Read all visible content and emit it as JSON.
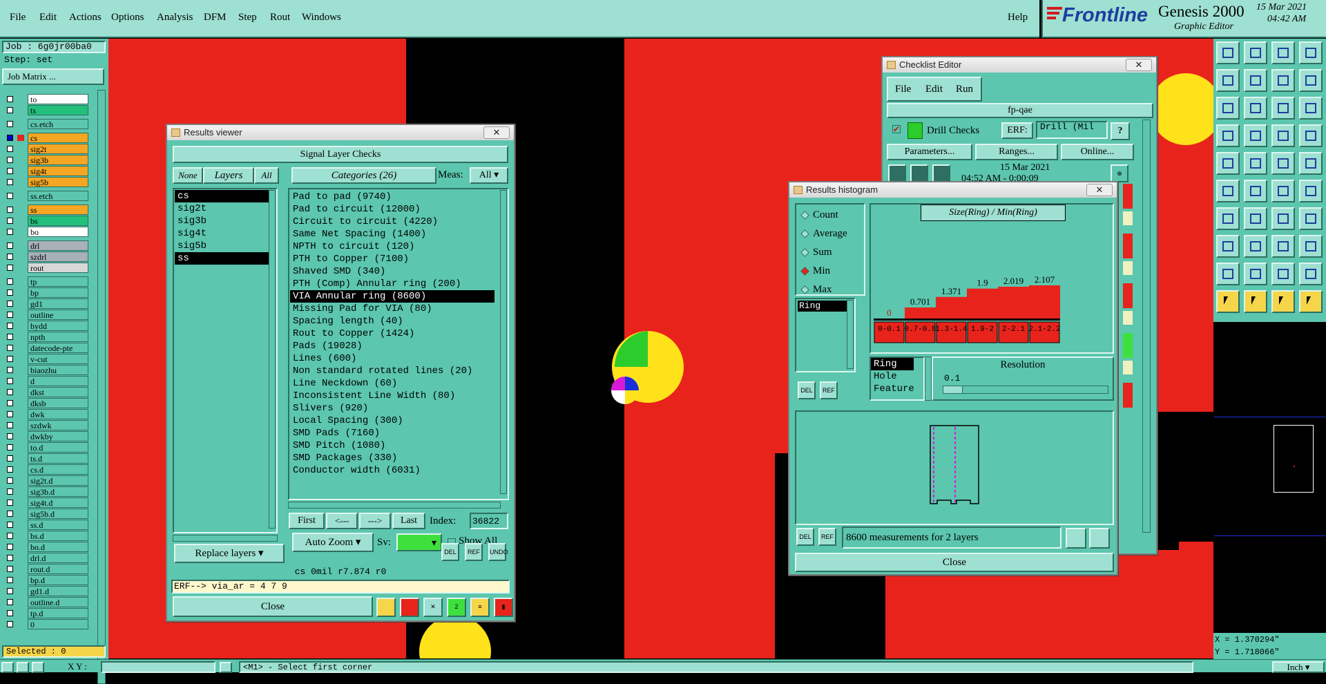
{
  "menu": {
    "items": [
      "File",
      "Edit",
      "Actions",
      "Options",
      "Analysis",
      "DFM",
      "Step",
      "Rout",
      "Windows"
    ],
    "help": "Help"
  },
  "brand": {
    "logo": "Frontline",
    "product": "Genesis 2000",
    "subtitle": "Graphic Editor",
    "date": "15 Mar 2021",
    "time": "04:42 AM"
  },
  "left": {
    "job": "Job : 6g0jr00ba0",
    "step": "Step: set",
    "job_matrix": "Job Matrix ...",
    "layers": [
      {
        "name": "to",
        "color": "#ffffff",
        "sel": false
      },
      {
        "name": "ts",
        "color": "#22c07a",
        "sel": false
      },
      {
        "name": "cs.etch",
        "color": "#5cc6ae",
        "sel": false
      },
      {
        "name": "cs",
        "color": "#f5a623",
        "sel": true
      },
      {
        "name": "sig2t",
        "color": "#f5a623",
        "sel": false
      },
      {
        "name": "sig3b",
        "color": "#f5a623",
        "sel": false
      },
      {
        "name": "sig4t",
        "color": "#f5a623",
        "sel": false
      },
      {
        "name": "sig5b",
        "color": "#f5a623",
        "sel": false
      },
      {
        "name": "ss.etch",
        "color": "#5cc6ae",
        "sel": false
      },
      {
        "name": "ss",
        "color": "#f5a623",
        "sel": false
      },
      {
        "name": "bs",
        "color": "#22c07a",
        "sel": false
      },
      {
        "name": "bo",
        "color": "#ffffff",
        "sel": false
      },
      {
        "name": "drl",
        "color": "#a8b0b8",
        "sel": false
      },
      {
        "name": "szdrl",
        "color": "#a8b0b8",
        "sel": false
      },
      {
        "name": "rout",
        "color": "#d8d8d8",
        "sel": false
      },
      {
        "name": "tp",
        "color": "#5cc6ae",
        "sel": false
      },
      {
        "name": "bp",
        "color": "#5cc6ae",
        "sel": false
      },
      {
        "name": "gd1",
        "color": "#5cc6ae",
        "sel": false
      },
      {
        "name": "outline",
        "color": "#5cc6ae",
        "sel": false
      },
      {
        "name": "bydd",
        "color": "#5cc6ae",
        "sel": false
      },
      {
        "name": "npth",
        "color": "#5cc6ae",
        "sel": false
      },
      {
        "name": "datecode-pte",
        "color": "#5cc6ae",
        "sel": false
      },
      {
        "name": "v-cut",
        "color": "#5cc6ae",
        "sel": false
      },
      {
        "name": "biaozhu",
        "color": "#5cc6ae",
        "sel": false
      },
      {
        "name": "d",
        "color": "#5cc6ae",
        "sel": false
      },
      {
        "name": "dkst",
        "color": "#5cc6ae",
        "sel": false
      },
      {
        "name": "dksb",
        "color": "#5cc6ae",
        "sel": false
      },
      {
        "name": "dwk",
        "color": "#5cc6ae",
        "sel": false
      },
      {
        "name": "szdwk",
        "color": "#5cc6ae",
        "sel": false
      },
      {
        "name": "dwkby",
        "color": "#5cc6ae",
        "sel": false
      },
      {
        "name": "to.d",
        "color": "#5cc6ae",
        "sel": false
      },
      {
        "name": "ts.d",
        "color": "#5cc6ae",
        "sel": false
      },
      {
        "name": "cs.d",
        "color": "#5cc6ae",
        "sel": false
      },
      {
        "name": "sig2t.d",
        "color": "#5cc6ae",
        "sel": false
      },
      {
        "name": "sig3b.d",
        "color": "#5cc6ae",
        "sel": false
      },
      {
        "name": "sig4t.d",
        "color": "#5cc6ae",
        "sel": false
      },
      {
        "name": "sig5b.d",
        "color": "#5cc6ae",
        "sel": false
      },
      {
        "name": "ss.d",
        "color": "#5cc6ae",
        "sel": false
      },
      {
        "name": "bs.d",
        "color": "#5cc6ae",
        "sel": false
      },
      {
        "name": "bo.d",
        "color": "#5cc6ae",
        "sel": false
      },
      {
        "name": "drl.d",
        "color": "#5cc6ae",
        "sel": false
      },
      {
        "name": "rout.d",
        "color": "#5cc6ae",
        "sel": false
      },
      {
        "name": "bp.d",
        "color": "#5cc6ae",
        "sel": false
      },
      {
        "name": "gd1.d",
        "color": "#5cc6ae",
        "sel": false
      },
      {
        "name": "outline.d",
        "color": "#5cc6ae",
        "sel": false
      },
      {
        "name": "tp.d",
        "color": "#5cc6ae",
        "sel": false
      },
      {
        "name": "0",
        "color": "#5cc6ae",
        "sel": false
      }
    ],
    "selected": "Selected : 0"
  },
  "results_viewer": {
    "title": "Results viewer",
    "header": "Signal Layer Checks",
    "none_btn": "None",
    "layers_btn": "Layers",
    "all_btn": "All",
    "categories_btn": "Categories (26)",
    "meas_label": "Meas:",
    "meas_value": "All",
    "layers": [
      "cs",
      "sig2t",
      "sig3b",
      "sig4t",
      "sig5b",
      "ss"
    ],
    "layers_sel": [
      0,
      5
    ],
    "categories": [
      "Pad to pad (9740)",
      "Pad to circuit (12000)",
      "Circuit to circuit (4220)",
      "Same Net Spacing (1400)",
      "NPTH to circuit (120)",
      "PTH to Copper (7100)",
      "Shaved SMD (340)",
      "PTH (Comp) Annular ring (200)",
      "VIA Annular ring (8600)",
      "Missing Pad for VIA (80)",
      "Spacing length (40)",
      "Rout to Copper (1424)",
      "Pads (19028)",
      "Lines (600)",
      "Non standard rotated lines (20)",
      "Line Neckdown (60)",
      "Inconsistent Line Width (80)",
      "Slivers (920)",
      "Local Spacing (300)",
      "SMD Pads (7160)",
      "SMD Pitch (1080)",
      "SMD Packages (330)",
      "Conductor width (6031)"
    ],
    "selected_category": 8,
    "first": "First",
    "prev": "<---",
    "next": "--->",
    "last": "Last",
    "index_label": "Index:",
    "index_value": "36822",
    "autozoom": "Auto Zoom",
    "sv_label": "Sv:",
    "show_all": "Show All",
    "replace_layers": "Replace layers",
    "info": "cs 0mil  r7.874  r0",
    "erf": "ERF--> via_ar = 4 7 9",
    "close": "Close",
    "icon_labels": {
      "del": "DEL",
      "ref": "REF",
      "undo": "UNDO"
    }
  },
  "checklist": {
    "title": "Checklist Editor",
    "menu": [
      "File",
      "Edit",
      "Run"
    ],
    "name": "fp-qae",
    "check": "Drill Checks",
    "erf_label": "ERF:",
    "erf_value": "Drill (Mil",
    "help": "?",
    "params": "Parameters...",
    "ranges": "Ranges...",
    "online": "Online...",
    "date": "15 Mar 2021",
    "time_line": "04:52 AM - 0:00:09"
  },
  "histogram": {
    "title": "Results histogram",
    "options": [
      "Count",
      "Average",
      "Sum",
      "Min",
      "Max"
    ],
    "selected_option": "Min",
    "list_item": "Ring",
    "chart_title": "Size(Ring) / Min(Ring)",
    "resolution_label": "Resolution",
    "resolution_value": "0.1",
    "attrs": [
      "Ring",
      "Hole",
      "Feature"
    ],
    "status": "8600 measurements for 2 layers",
    "close": "Close",
    "del": "DEL",
    "ref": "REF"
  },
  "chart_data": {
    "type": "bar",
    "title": "Size(Ring) / Min(Ring)",
    "categories": [
      "0-0.1",
      "0.7-0.8",
      "1.3-1.4",
      "1.9-2",
      "2-2.1",
      "2.1-2.2"
    ],
    "values": [
      0,
      0.701,
      1.371,
      1.9,
      2.019,
      2.107
    ],
    "value_labels": [
      "0",
      "0.701",
      "1.371",
      "1.9",
      "2.019",
      "2.107"
    ],
    "bar_color": "#e8231b"
  },
  "coords": {
    "x": "X = 1.370294\"",
    "y": "Y = 1.718066\""
  },
  "status": {
    "xy_label": "X Y :",
    "message": "<M1> - Select first corner",
    "units": "Inch"
  },
  "colors": {
    "accent": "#5cc6ae",
    "copper": "#e8231b",
    "pad": "#ffe21a",
    "brand_red": "#d21c20",
    "brand_blue": "#1f3d9e"
  }
}
